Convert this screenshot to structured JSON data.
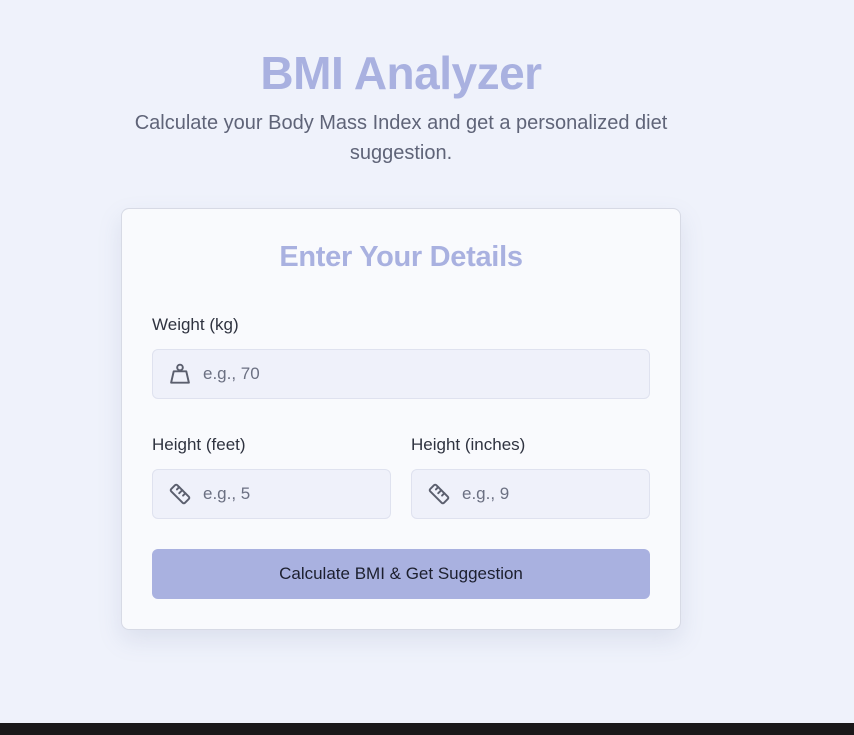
{
  "header": {
    "title": "BMI Analyzer",
    "subtitle": "Calculate your Body Mass Index and get a personalized diet suggestion."
  },
  "form": {
    "title": "Enter Your Details",
    "weight": {
      "label": "Weight (kg)",
      "placeholder": "e.g., 70",
      "value": "",
      "icon": "weight-icon"
    },
    "height_feet": {
      "label": "Height (feet)",
      "placeholder": "e.g., 5",
      "value": "",
      "icon": "ruler-icon"
    },
    "height_inches": {
      "label": "Height (inches)",
      "placeholder": "e.g., 9",
      "value": "",
      "icon": "ruler-icon"
    },
    "submit_label": "Calculate BMI & Get Suggestion"
  },
  "colors": {
    "accent": "#a9b1e0",
    "background": "#eff2fb",
    "card": "#f9fafd",
    "field": "#eff1fa",
    "text": "#2f3340",
    "muted": "#5f6478"
  }
}
